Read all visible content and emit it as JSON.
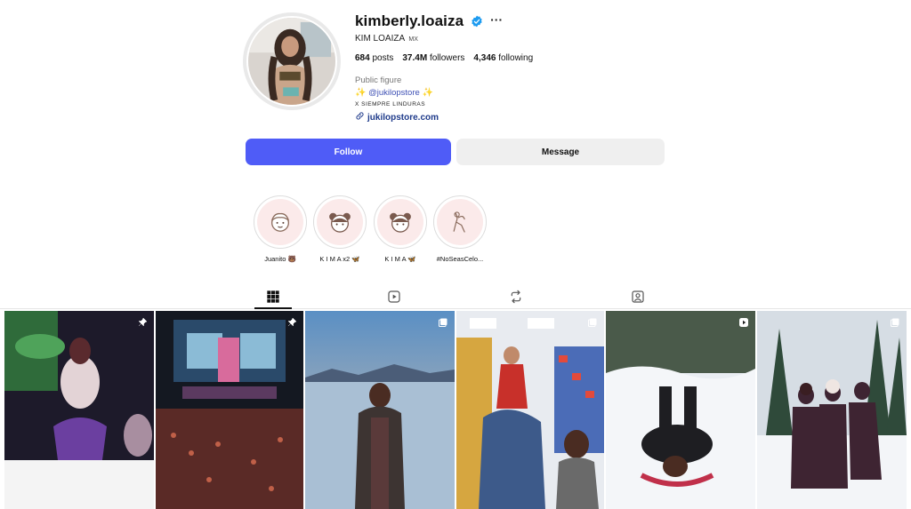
{
  "profile": {
    "username": "kimberly.loaiza",
    "full_name": "KIM LOAIZA",
    "country_tag": "MX",
    "posts_count": "684",
    "posts_label": "posts",
    "followers_count": "37.4M",
    "followers_label": "followers",
    "following_count": "4,346",
    "following_label": "following",
    "category": "Public figure",
    "bio_mention": "@jukilopstore",
    "bio_tagline": "X SIEMPRE LINDURAS",
    "link": "jukilopstore.com"
  },
  "actions": {
    "follow_label": "Follow",
    "message_label": "Message"
  },
  "highlights": [
    {
      "label": "Juanito 🐻"
    },
    {
      "label": "K I M A x2 🦋"
    },
    {
      "label": "K I M A 🦋"
    },
    {
      "label": "#NoSeasCelo..."
    }
  ],
  "tabs": [
    {
      "icon": "grid-icon",
      "active": true
    },
    {
      "icon": "reels-icon",
      "active": false
    },
    {
      "icon": "reposts-icon",
      "active": false
    },
    {
      "icon": "tagged-icon",
      "active": false
    }
  ],
  "colors": {
    "follow_button": "#4f5cf7",
    "message_button": "#efefef",
    "verified_badge": "#1d9bf0",
    "link": "#1e3a8a"
  }
}
